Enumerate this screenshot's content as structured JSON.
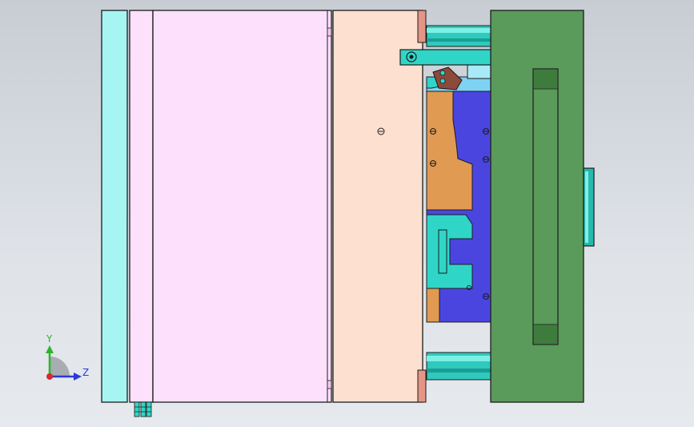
{
  "viewport": {
    "background_top": "#c8cdd4",
    "background_bottom": "#e6e9ed"
  },
  "colors": {
    "cyan_plate": "#a6f5f3",
    "pink_plate": "#fde0fb",
    "salmon_plate": "#fde0cf",
    "green_plate": "#5a9a5a",
    "blue_block": "#4b45e0",
    "orange_core": "#e19a52",
    "teal_parts": "#2fd6c7",
    "outline": "#1c1c1c"
  },
  "triad": {
    "y_label": "Y",
    "z_label": "Z",
    "y_color": "#2cb52c",
    "z_color": "#2a3ad8",
    "x_color": "#d82a2a"
  }
}
